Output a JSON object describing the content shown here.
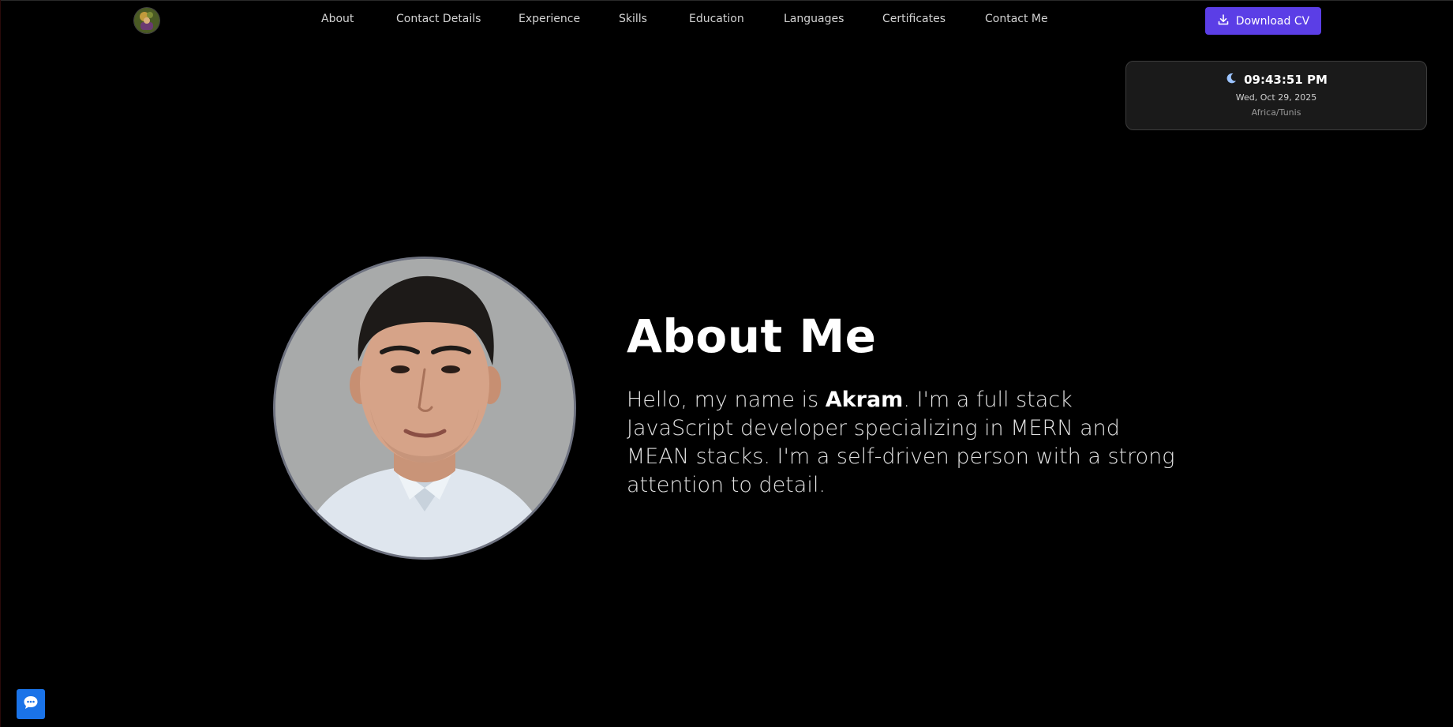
{
  "nav": {
    "logo_icon": "profile-avatar-icon",
    "links": [
      {
        "label": "About"
      },
      {
        "label": "Contact Details"
      },
      {
        "label": "Experience"
      },
      {
        "label": "Skills"
      },
      {
        "label": "Education"
      },
      {
        "label": "Languages"
      },
      {
        "label": "Certificates"
      },
      {
        "label": "Contact Me"
      }
    ],
    "download_label": "Download CV",
    "download_icon": "download-icon"
  },
  "clock": {
    "icon": "moon-icon",
    "time": "09:43:51 PM",
    "date": "Wed, Oct 29, 2025",
    "timezone": "Africa/Tunis"
  },
  "about": {
    "title": "About Me",
    "text_prefix": "Hello, my name is ",
    "name": "Akram",
    "text_suffix": ". I'm a full stack JavaScript developer specializing in MERN and MEAN stacks. I'm a self-driven person with a strong attention to detail."
  },
  "chat": {
    "icon": "chat-bubble-icon"
  },
  "colors": {
    "background": "#000000",
    "accent": "#5b3ee6",
    "chat_button": "#1a73e8",
    "card_bg": "#1a1a1a"
  }
}
